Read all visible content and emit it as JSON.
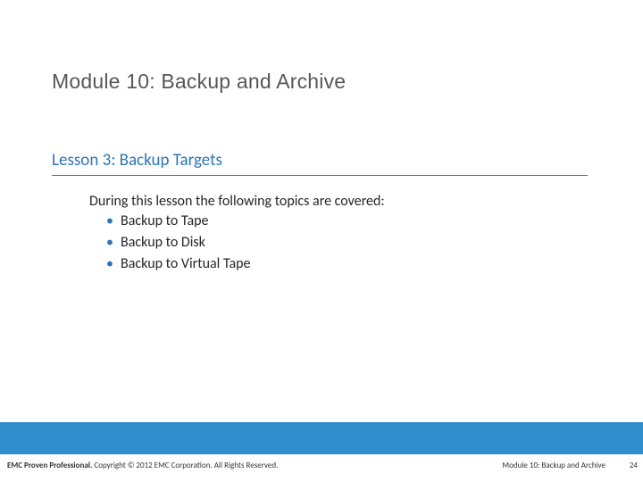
{
  "module_title": "Module 10: Backup and Archive",
  "lesson_title": "Lesson 3: Backup Targets",
  "intro": "During this lesson the following topics are covered:",
  "bullets": {
    "b0": "Backup to Tape",
    "b1": "Backup to Disk",
    "b2": "Backup to Virtual Tape"
  },
  "footer": {
    "brand": "EMC Proven Professional.",
    "copyright": " Copyright © 2012 EMC Corporation. All Rights Reserved.",
    "module": "Module 10: Backup and Archive",
    "page": "24"
  }
}
